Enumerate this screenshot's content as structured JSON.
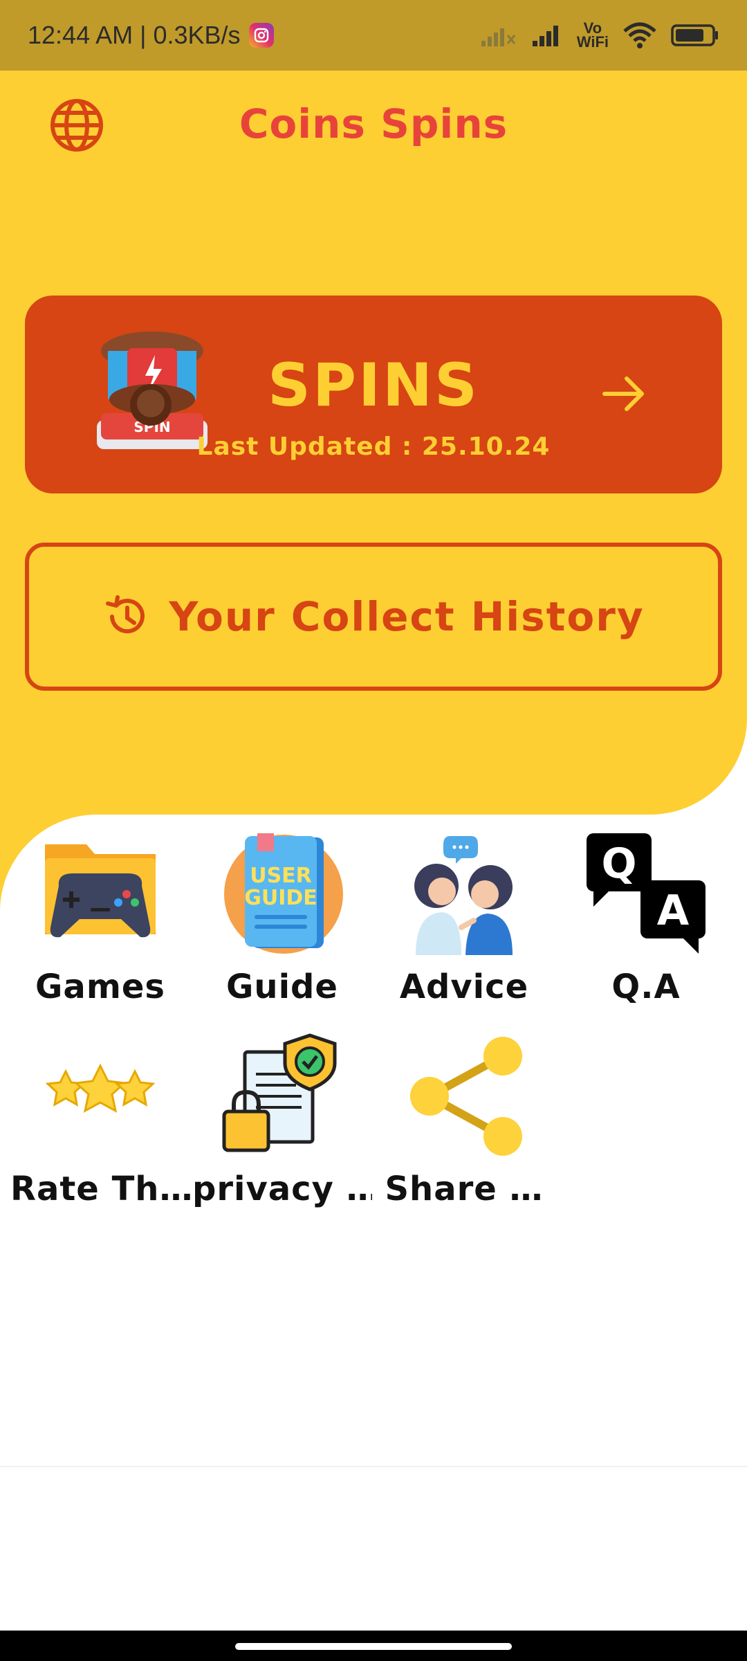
{
  "status_bar": {
    "time_speed": "12:44 AM | 0.3KB/s",
    "vowifi_top": "Vo",
    "vowifi_bottom": "WiFi",
    "battery_level": 0.8
  },
  "header": {
    "title": "Coins Spins"
  },
  "spins_card": {
    "label": "SPINS",
    "badge_text": "SPIN",
    "last_updated": "Last Updated : 25.10.24"
  },
  "history": {
    "label": "Your Collect History"
  },
  "grid": [
    {
      "label": "Games"
    },
    {
      "label": "Guide"
    },
    {
      "label": "Advice"
    },
    {
      "label": "Q.A"
    },
    {
      "label": "Rate Th…"
    },
    {
      "label": "privacy …"
    },
    {
      "label": "Share …"
    }
  ],
  "guide_icon_text": {
    "line1": "USER",
    "line2": "GUIDE"
  },
  "qa_icon_text": {
    "q": "Q",
    "a": "A"
  },
  "colors": {
    "status_bar": "#C09B2A",
    "yellow": "#FDCF33",
    "orange": "#D64513",
    "title_red": "#E8433A"
  }
}
